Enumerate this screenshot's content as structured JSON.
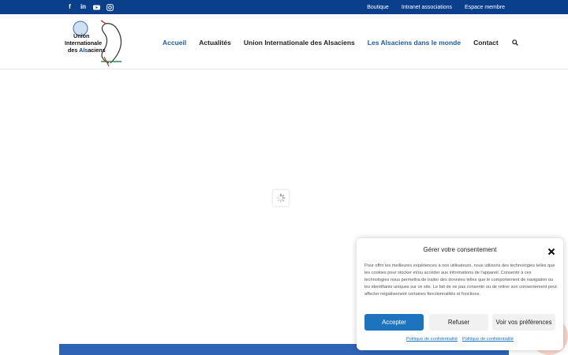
{
  "colors": {
    "topbar": "#0a3f8c",
    "nav_active": "#1f5aa6",
    "accept_button": "#1e73be",
    "bottom_bar": "#2f63b5"
  },
  "topbar": {
    "social_icons": [
      "facebook-icon",
      "linkedin-icon",
      "youtube-icon",
      "instagram-icon"
    ],
    "links": [
      "Boutique",
      "Intranet associations",
      "Espace membre"
    ]
  },
  "logo": {
    "line1": "Union",
    "line2": "Internationale",
    "line3_pre": "des ",
    "line3_mid": "Als",
    "line3_post": "aciens"
  },
  "nav": {
    "items": [
      "Accueil",
      "Actualités",
      "Union Internationale des Alsaciens",
      "Les Alsaciens dans le monde",
      "Contact"
    ]
  },
  "consent": {
    "title": "Gérer votre consentement",
    "body": "Pour offrir les meilleures expériences à nos utilisateurs, nous utilisons des technologies telles que les cookies pour stocker et/ou accéder aux informations de l'appareil. Consentir à ces technologies nous permettra de traiter des données telles que le comportement de navigation ou les identifiants uniques sur ce site. Le fait de ne pas consentir ou de retirer son consentement peut affecter négativement certaines fonctionnalités et fonctions.",
    "accept": "Accepter",
    "refuse": "Refuser",
    "preferences": "Voir vos préférences",
    "link1": "Politique de confidentialité",
    "link2": "Politique de confidentialité"
  }
}
